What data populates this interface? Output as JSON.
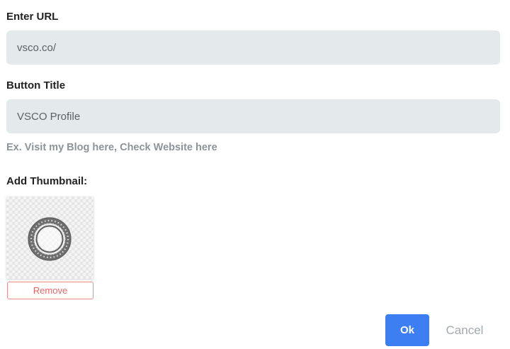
{
  "url_section": {
    "label": "Enter URL",
    "value": "vsco.co/"
  },
  "title_section": {
    "label": "Button Title",
    "value": "VSCO Profile",
    "hint": "Ex. Visit my Blog here, Check Website here"
  },
  "thumbnail_section": {
    "label": "Add Thumbnail:",
    "image_icon": "vsco-logo-icon",
    "remove_label": "Remove"
  },
  "actions": {
    "ok_label": "Ok",
    "cancel_label": "Cancel"
  },
  "colors": {
    "field_bg": "#e4e9ec",
    "primary": "#3d7ff2",
    "danger": "#e86464",
    "muted": "#a3a8ad"
  }
}
